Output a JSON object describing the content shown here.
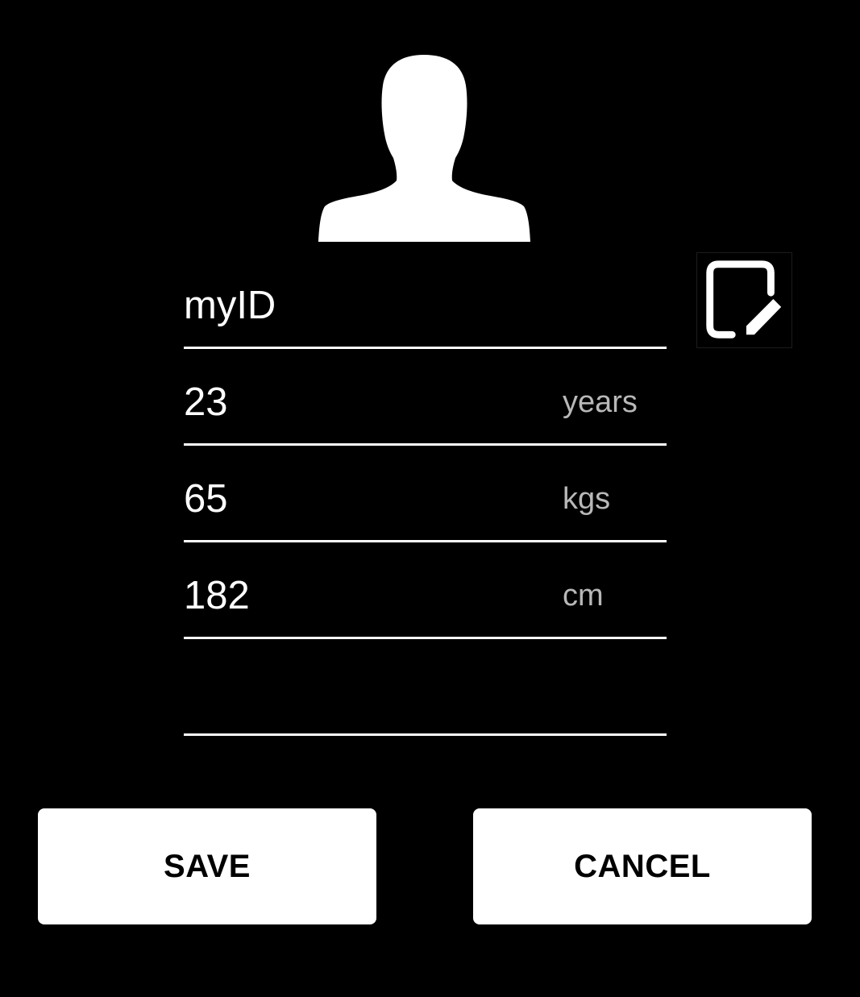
{
  "profile": {
    "avatar_icon": "person-silhouette-icon",
    "edit_icon": "edit-document-icon",
    "fields": {
      "id": {
        "value": "myID",
        "unit": ""
      },
      "age": {
        "value": "23",
        "unit": "years"
      },
      "weight": {
        "value": "65",
        "unit": "kgs"
      },
      "height": {
        "value": "182",
        "unit": "cm"
      },
      "extra": {
        "value": "",
        "unit": ""
      }
    }
  },
  "actions": {
    "save_label": "SAVE",
    "cancel_label": "CANCEL"
  },
  "colors": {
    "background": "#000000",
    "foreground": "#ffffff",
    "unit_text": "#b8b8b8",
    "button_bg": "#ffffff",
    "button_text": "#000000"
  }
}
